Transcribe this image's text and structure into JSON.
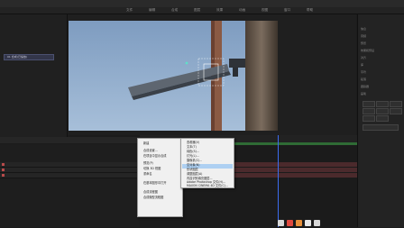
{
  "menu": {
    "items": [
      "文件",
      "编辑",
      "合成",
      "图层",
      "效果",
      "动画",
      "视图",
      "窗口",
      "帮助"
    ]
  },
  "project": {
    "selected_item": "01 合成(已缩放)"
  },
  "context_menu": {
    "items": [
      "新建",
      "合成设置...",
      "在项目中显示合成",
      "预览(P)",
      "切换 3D 视图",
      "重命名",
      "在基本图形中打开",
      "合成流程图",
      "合成微型流程图"
    ],
    "submenu": [
      "查看器(V)",
      "文本(T)",
      "纯色(S)...",
      "灯光(L)...",
      "摄像机(C)...",
      "空对象(N)",
      "形状图层",
      "调整图层(A)",
      "内容识别填充图层...",
      "Adobe Photoshop 文件(H)...",
      "MAXON CINEMA 4D 文件(C)..."
    ],
    "highlighted_index": 6
  },
  "right_panel": {
    "labels": [
      "信息",
      "音频",
      "预览",
      "效果和预设",
      "对齐",
      "库",
      "字符",
      "段落",
      "跟踪器",
      "画笔"
    ]
  },
  "colors": {
    "accent": "#3c6cf0",
    "work_area": "#2f6b35",
    "layer_bar": "#4b2a2c",
    "highlight": "#aed0f2"
  }
}
